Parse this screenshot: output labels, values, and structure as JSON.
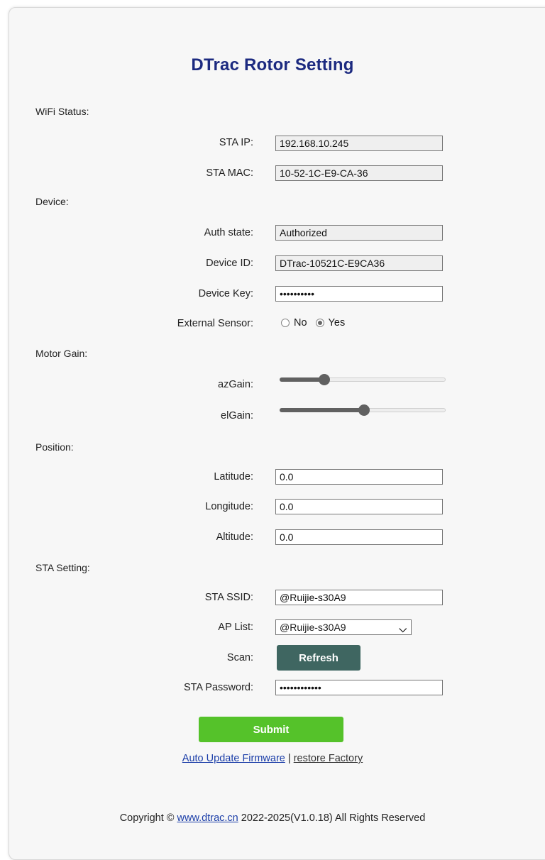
{
  "title": "DTrac Rotor Setting",
  "wifi": {
    "section": "WiFi Status:",
    "sta_ip_label": "STA IP:",
    "sta_ip": "192.168.10.245",
    "sta_mac_label": "STA MAC:",
    "sta_mac": "10-52-1C-E9-CA-36"
  },
  "device": {
    "section": "Device:",
    "auth_label": "Auth state:",
    "auth": "Authorized",
    "id_label": "Device ID:",
    "id": "DTrac-10521C-E9CA36",
    "key_label": "Device Key:",
    "key": "••••••••••",
    "ext_sensor_label": "External Sensor:",
    "ext_no": "No",
    "ext_yes": "Yes",
    "ext_selected": "Yes"
  },
  "motor": {
    "section": "Motor Gain:",
    "az_label": "azGain:",
    "az_value_fraction": 0.27,
    "el_label": "elGain:",
    "el_value_fraction": 0.51
  },
  "position": {
    "section": "Position:",
    "lat_label": "Latitude:",
    "lat": "0.0",
    "lon_label": "Longitude:",
    "lon": "0.0",
    "alt_label": "Altitude:",
    "alt": "0.0"
  },
  "sta": {
    "section": "STA Setting:",
    "ssid_label": "STA SSID:",
    "ssid": "@Ruijie-s30A9",
    "ap_label": "AP List:",
    "ap_selected": "@Ruijie-s30A9",
    "scan_label": "Scan:",
    "refresh": "Refresh",
    "pwd_label": "STA Password:",
    "pwd": "••••••••••••"
  },
  "submit": "Submit",
  "links": {
    "update": "Auto Update Firmware",
    "sep": "|",
    "restore": "restore Factory"
  },
  "footer": {
    "prefix": "Copyright ©",
    "site": "www.dtrac.cn",
    "suffix": "2022-2025(V1.0.18) All Rights Reserved"
  }
}
